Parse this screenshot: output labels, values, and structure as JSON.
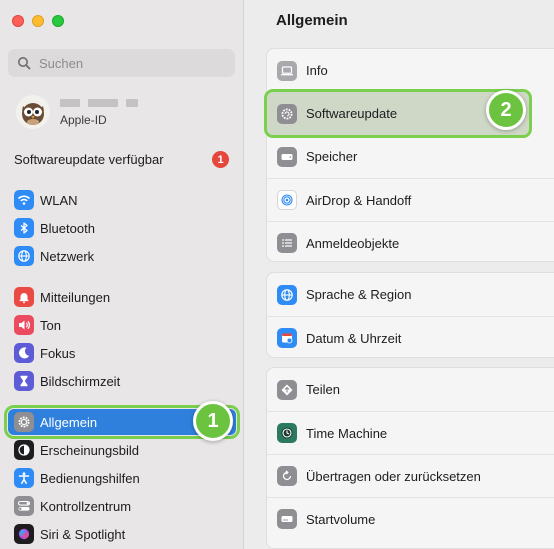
{
  "sidebar": {
    "search_placeholder": "Suchen",
    "account_label": "Apple-ID",
    "update_text": "Softwareupdate verfügbar",
    "update_count": "1",
    "items": [
      {
        "label": "WLAN",
        "icon": "wifi-icon",
        "color": "#2f8cf6"
      },
      {
        "label": "Bluetooth",
        "icon": "bluetooth-icon",
        "color": "#2f8cf6"
      },
      {
        "label": "Netzwerk",
        "icon": "globe-icon",
        "color": "#2f8cf6"
      },
      {
        "label": "Mitteilungen",
        "icon": "bell-icon",
        "color": "#eb4a44"
      },
      {
        "label": "Ton",
        "icon": "speaker-icon",
        "color": "#eb4a5f"
      },
      {
        "label": "Fokus",
        "icon": "moon-icon",
        "color": "#5d5cd6"
      },
      {
        "label": "Bildschirmzeit",
        "icon": "hourglass-icon",
        "color": "#5d5cd6"
      },
      {
        "label": "Allgemein",
        "icon": "gear-icon",
        "color": "#8e8e93"
      },
      {
        "label": "Erscheinungsbild",
        "icon": "appearance-icon",
        "color": "#1d1d1f"
      },
      {
        "label": "Bedienungshilfen",
        "icon": "accessibility-icon",
        "color": "#2f8cf6"
      },
      {
        "label": "Kontrollzentrum",
        "icon": "control-center-icon",
        "color": "#8e8e93"
      },
      {
        "label": "Siri & Spotlight",
        "icon": "siri-icon",
        "color": "#1d1d1f"
      }
    ]
  },
  "main": {
    "title": "Allgemein",
    "group1": [
      "Info",
      "Softwareupdate",
      "Speicher",
      "AirDrop & Handoff",
      "Anmeldeobjekte"
    ],
    "group2": [
      "Sprache & Region",
      "Datum & Uhrzeit"
    ],
    "group3": [
      "Teilen",
      "Time Machine",
      "Übertragen oder zurücksetzen",
      "Startvolume"
    ]
  },
  "annotations": {
    "step1": "1",
    "step2": "2"
  },
  "colors": {
    "accent": "#2f7fdc",
    "highlight_green": "#7ad04e",
    "badge_red": "#e5473d"
  }
}
